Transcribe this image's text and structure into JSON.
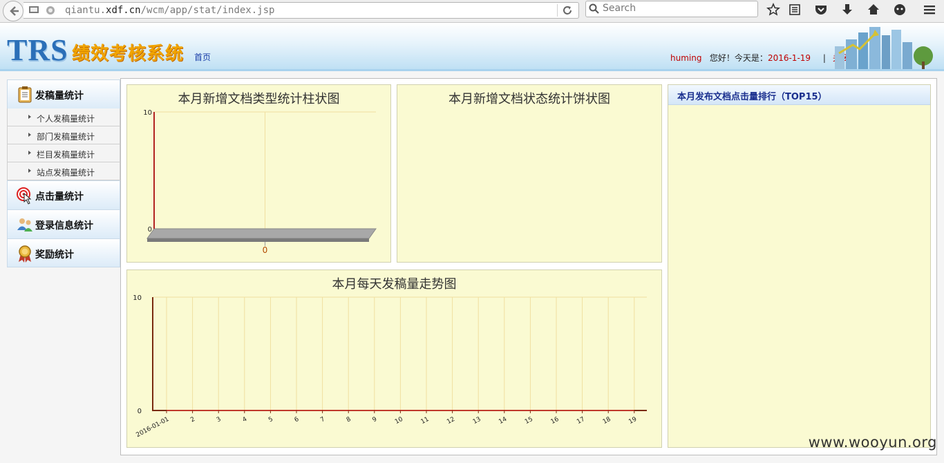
{
  "browser": {
    "url_prefix": "qiantu.",
    "url_domain": "xdf.cn",
    "url_path": "/wcm/app/stat/index.jsp",
    "search_placeholder": "Search"
  },
  "header": {
    "logo_trs": "TRS",
    "logo_system": "绩效考核系统",
    "home_link": "首页",
    "username": "huming",
    "greeting": "您好！今天是：",
    "date": "2016-1-19",
    "divider": "|",
    "close_link": "关闭"
  },
  "sidebar": {
    "sections": [
      {
        "title": "发稿量统计",
        "icon": "clipboard-icon",
        "items": [
          "个人发稿量统计",
          "部门发稿量统计",
          "栏目发稿量统计",
          "站点发稿量统计"
        ]
      },
      {
        "title": "点击量统计",
        "icon": "target-click-icon"
      },
      {
        "title": "登录信息统计",
        "icon": "users-icon"
      },
      {
        "title": "奖励统计",
        "icon": "medal-icon"
      }
    ]
  },
  "panels": {
    "bar_title": "本月新增文档类型统计柱状图",
    "pie_title": "本月新增文档状态统计饼状图",
    "trend_title": "本月每天发稿量走势图",
    "rank_title": "本月发布文档点击量排行（TOP15）"
  },
  "chart_data": [
    {
      "type": "bar",
      "title": "本月新增文档类型统计柱状图",
      "categories": [
        "0"
      ],
      "values": [
        0
      ],
      "ylim": [
        0,
        10
      ],
      "yticks": [
        "10",
        "0"
      ]
    },
    {
      "type": "pie",
      "title": "本月新增文档状态统计饼状图",
      "values": []
    },
    {
      "type": "line",
      "title": "本月每天发稿量走势图",
      "x": [
        "2016-01-01",
        "2",
        "3",
        "4",
        "5",
        "6",
        "7",
        "8",
        "9",
        "10",
        "11",
        "12",
        "13",
        "14",
        "15",
        "16",
        "17",
        "18",
        "19"
      ],
      "values": [
        0,
        0,
        0,
        0,
        0,
        0,
        0,
        0,
        0,
        0,
        0,
        0,
        0,
        0,
        0,
        0,
        0,
        0,
        0
      ],
      "ylim": [
        0,
        10
      ],
      "yticks": [
        "10",
        "0"
      ]
    }
  ],
  "watermark": "www.wooyun.org"
}
